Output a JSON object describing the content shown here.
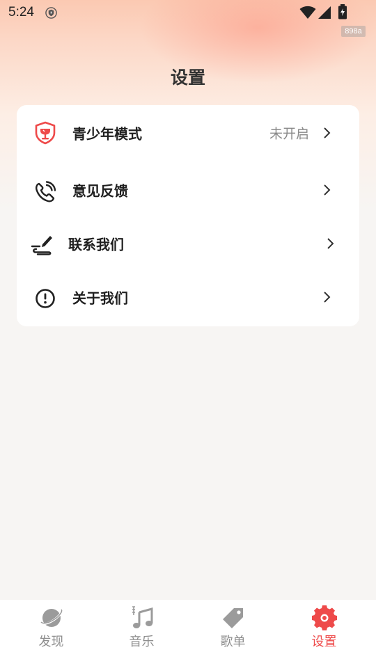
{
  "status_bar": {
    "time": "5:24",
    "build_tag": "898a"
  },
  "page": {
    "title": "设置"
  },
  "settings": {
    "items": [
      {
        "label": "青少年模式",
        "value": "未开启",
        "icon": "youth-shield-icon"
      },
      {
        "label": "意见反馈",
        "value": "",
        "icon": "phone-feedback-icon"
      },
      {
        "label": "联系我们",
        "value": "",
        "icon": "pen-sign-icon"
      },
      {
        "label": "关于我们",
        "value": "",
        "icon": "info-exclamation-icon"
      }
    ]
  },
  "tabbar": {
    "tabs": [
      {
        "label": "发现",
        "icon": "planet-icon",
        "active": false
      },
      {
        "label": "音乐",
        "icon": "music-note-icon",
        "active": false
      },
      {
        "label": "歌单",
        "icon": "tag-icon",
        "active": false
      },
      {
        "label": "设置",
        "icon": "gear-icon",
        "active": true
      }
    ]
  },
  "colors": {
    "accent": "#ee4a4a",
    "inactive_tab": "#8e8e8e",
    "background": "#f7f5f3",
    "card": "#ffffff"
  }
}
